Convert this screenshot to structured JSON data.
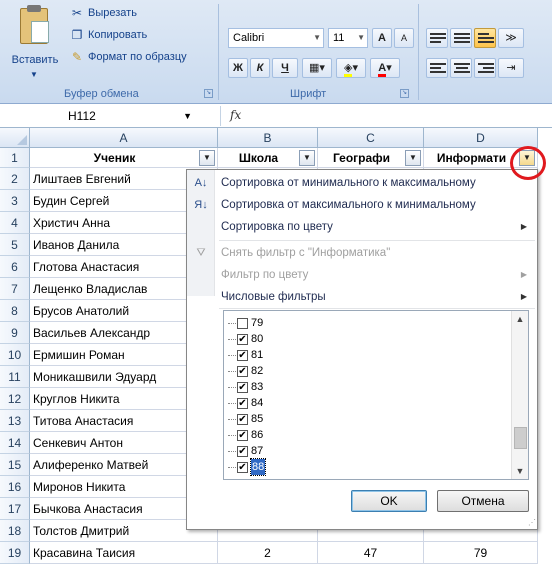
{
  "ribbon": {
    "clipboard": {
      "paste_label": "Вставить",
      "cut_label": "Вырезать",
      "copy_label": "Копировать",
      "format_painter_label": "Формат по образцу",
      "group_label": "Буфер обмена"
    },
    "font": {
      "font_name": "Calibri",
      "font_size": "11",
      "bold": "Ж",
      "italic": "К",
      "underline": "Ч",
      "group_label": "Шрифт",
      "grow": "A",
      "shrink": "A"
    }
  },
  "formula_bar": {
    "name_box": "H112",
    "fx": "fx",
    "value": ""
  },
  "columns": [
    "A",
    "B",
    "C",
    "D"
  ],
  "header_row": {
    "row": "1",
    "cells": [
      "Ученик",
      "Школа",
      "Географи",
      "Информати"
    ]
  },
  "rows": [
    {
      "n": "2",
      "name": "Лиштаев Евгений"
    },
    {
      "n": "3",
      "name": "Будин Сергей"
    },
    {
      "n": "4",
      "name": "Христич Анна"
    },
    {
      "n": "5",
      "name": "Иванов Данила"
    },
    {
      "n": "6",
      "name": "Глотова Анастасия"
    },
    {
      "n": "7",
      "name": "Лещенко Владислав"
    },
    {
      "n": "8",
      "name": "Брусов Анатолий"
    },
    {
      "n": "9",
      "name": "Васильев Александр"
    },
    {
      "n": "10",
      "name": "Ермишин Роман"
    },
    {
      "n": "11",
      "name": "Моникашвили Эдуард"
    },
    {
      "n": "12",
      "name": "Круглов Никита"
    },
    {
      "n": "13",
      "name": "Титова Анастасия"
    },
    {
      "n": "14",
      "name": "Сенкевич Антон"
    },
    {
      "n": "15",
      "name": "Алиференко Матвей"
    },
    {
      "n": "16",
      "name": "Миронов Никита"
    },
    {
      "n": "17",
      "name": "Бычкова Анастасия"
    },
    {
      "n": "18",
      "name": "Толстов Дмитрий"
    },
    {
      "n": "19",
      "name": "Красавина Таисия",
      "b": "2",
      "c": "47",
      "d": "79"
    }
  ],
  "filter_menu": {
    "sort_asc": "Сортировка от минимального к максимальному",
    "sort_desc": "Сортировка от максимального к минимальному",
    "sort_color": "Сортировка по цвету",
    "clear_filter": "Снять фильтр с \"Информатика\"",
    "filter_color": "Фильтр по цвету",
    "number_filters": "Числовые фильтры",
    "values": [
      {
        "label": "79",
        "checked": false
      },
      {
        "label": "80",
        "checked": true
      },
      {
        "label": "81",
        "checked": true
      },
      {
        "label": "82",
        "checked": true
      },
      {
        "label": "83",
        "checked": true
      },
      {
        "label": "84",
        "checked": true
      },
      {
        "label": "85",
        "checked": true
      },
      {
        "label": "86",
        "checked": true
      },
      {
        "label": "87",
        "checked": true
      },
      {
        "label": "88",
        "checked": true
      }
    ],
    "ok": "OK",
    "cancel": "Отмена"
  },
  "icons": [
    "paste-icon",
    "cut-icon",
    "copy-icon",
    "format-painter-icon",
    "sort-asc-icon",
    "sort-desc-icon",
    "clear-filter-icon"
  ],
  "colors": {
    "highlight_circle": "#e0191e",
    "selection": "#316ac5"
  }
}
